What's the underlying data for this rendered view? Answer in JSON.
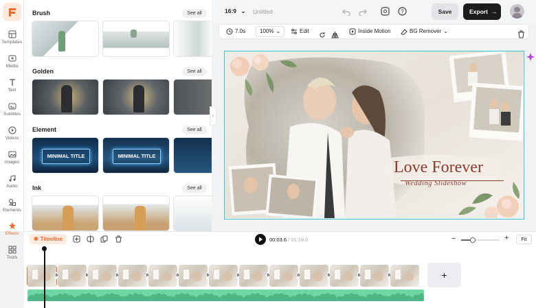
{
  "nav": {
    "items": [
      {
        "label": "Templates"
      },
      {
        "label": "Media"
      },
      {
        "label": "Text"
      },
      {
        "label": "Subtitles"
      },
      {
        "label": "Videos"
      },
      {
        "label": "Images"
      },
      {
        "label": "Audio"
      },
      {
        "label": "Elements"
      },
      {
        "label": "Effects"
      },
      {
        "label": "Tools"
      }
    ]
  },
  "panel": {
    "see_all": "See all",
    "sections": [
      {
        "title": "Brush"
      },
      {
        "title": "Golden"
      },
      {
        "title": "Element",
        "thumb_text": "MINIMAL TITLE"
      },
      {
        "title": "Ink"
      }
    ]
  },
  "header": {
    "aspect": "16:9",
    "title": "Untitled",
    "save": "Save",
    "export": "Export"
  },
  "toolbar": {
    "duration": "7.0s",
    "zoom": "100%",
    "edit": "Edit",
    "inside_motion": "Inside Motion",
    "bg_remover": "BG Remover"
  },
  "canvas": {
    "headline": "Love Forever",
    "subline": "Wedding Slideshow"
  },
  "timeline": {
    "tab": "Timeline",
    "current_time": "00:03.6",
    "separator": "/",
    "total_time": "01:19.0",
    "fit": "Fit",
    "zoom_level": 0.3
  },
  "colors": {
    "accent": "#f06a2a",
    "selection": "#3bc3d6",
    "audio": "#6fd6a6",
    "dark": "#1c1c1e"
  }
}
